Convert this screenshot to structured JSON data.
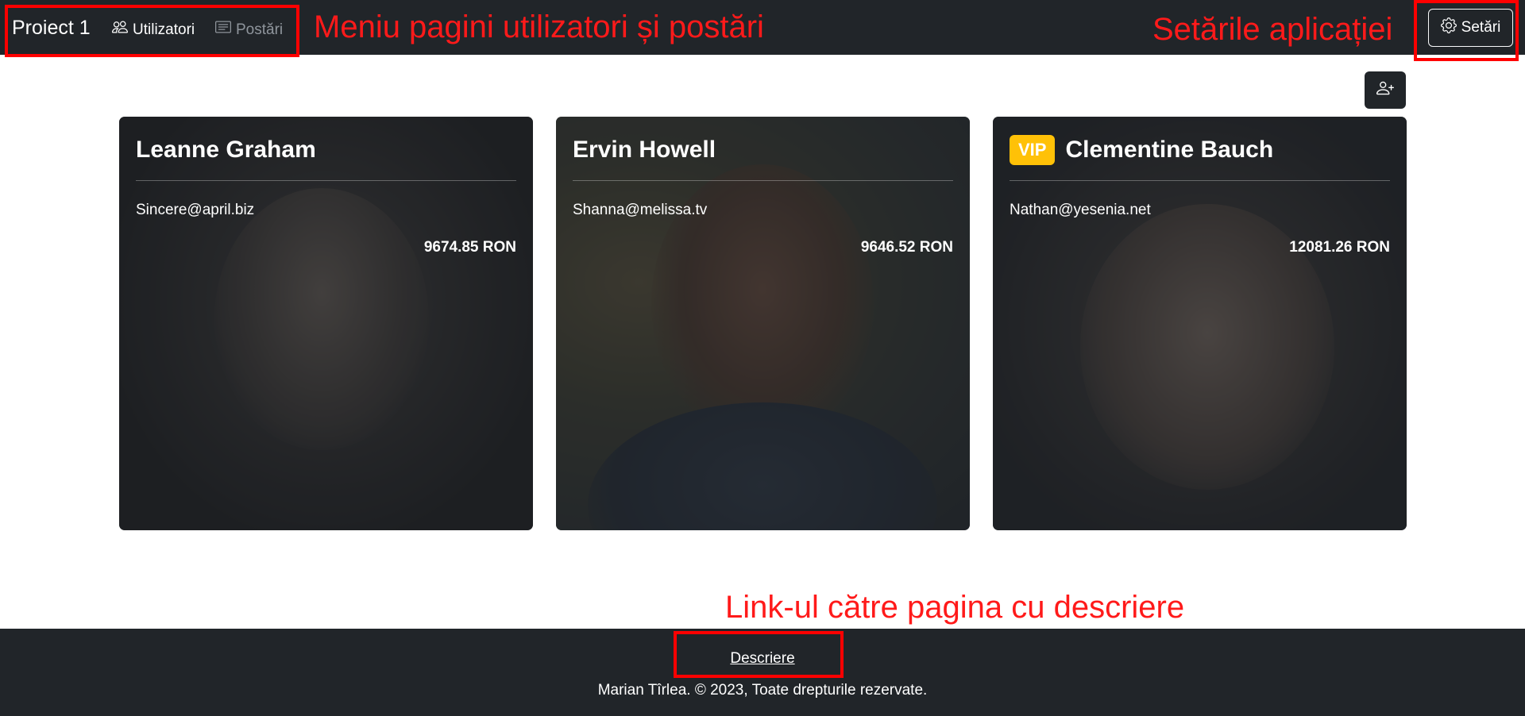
{
  "navbar": {
    "brand": "Proiect 1",
    "links": [
      {
        "label": "Utilizatori",
        "icon": "users-icon",
        "active": true
      },
      {
        "label": "Postări",
        "icon": "card-text-icon",
        "active": false
      }
    ],
    "settings_label": "Setări",
    "settings_icon": "gear-icon"
  },
  "annotations": {
    "menu": "Meniu pagini utilizatori și postări",
    "settings": "Setările aplicației",
    "description_link": "Link-ul către pagina cu descriere"
  },
  "actions": {
    "add_user_icon": "person-plus-icon"
  },
  "users": [
    {
      "name": "Leanne Graham",
      "email": "Sincere@april.biz",
      "balance": "9674.85 RON",
      "vip": ""
    },
    {
      "name": "Ervin Howell",
      "email": "Shanna@melissa.tv",
      "balance": "9646.52 RON",
      "vip": ""
    },
    {
      "name": "Clementine Bauch",
      "email": "Nathan@yesenia.net",
      "balance": "12081.26 RON",
      "vip": "VIP"
    }
  ],
  "footer": {
    "link": "Descriere",
    "copyright": "Marian Tîrlea. © 2023, Toate drepturile rezervate."
  },
  "colors": {
    "dark": "#212529",
    "vip": "#ffc107",
    "annotation": "#ff0000"
  }
}
